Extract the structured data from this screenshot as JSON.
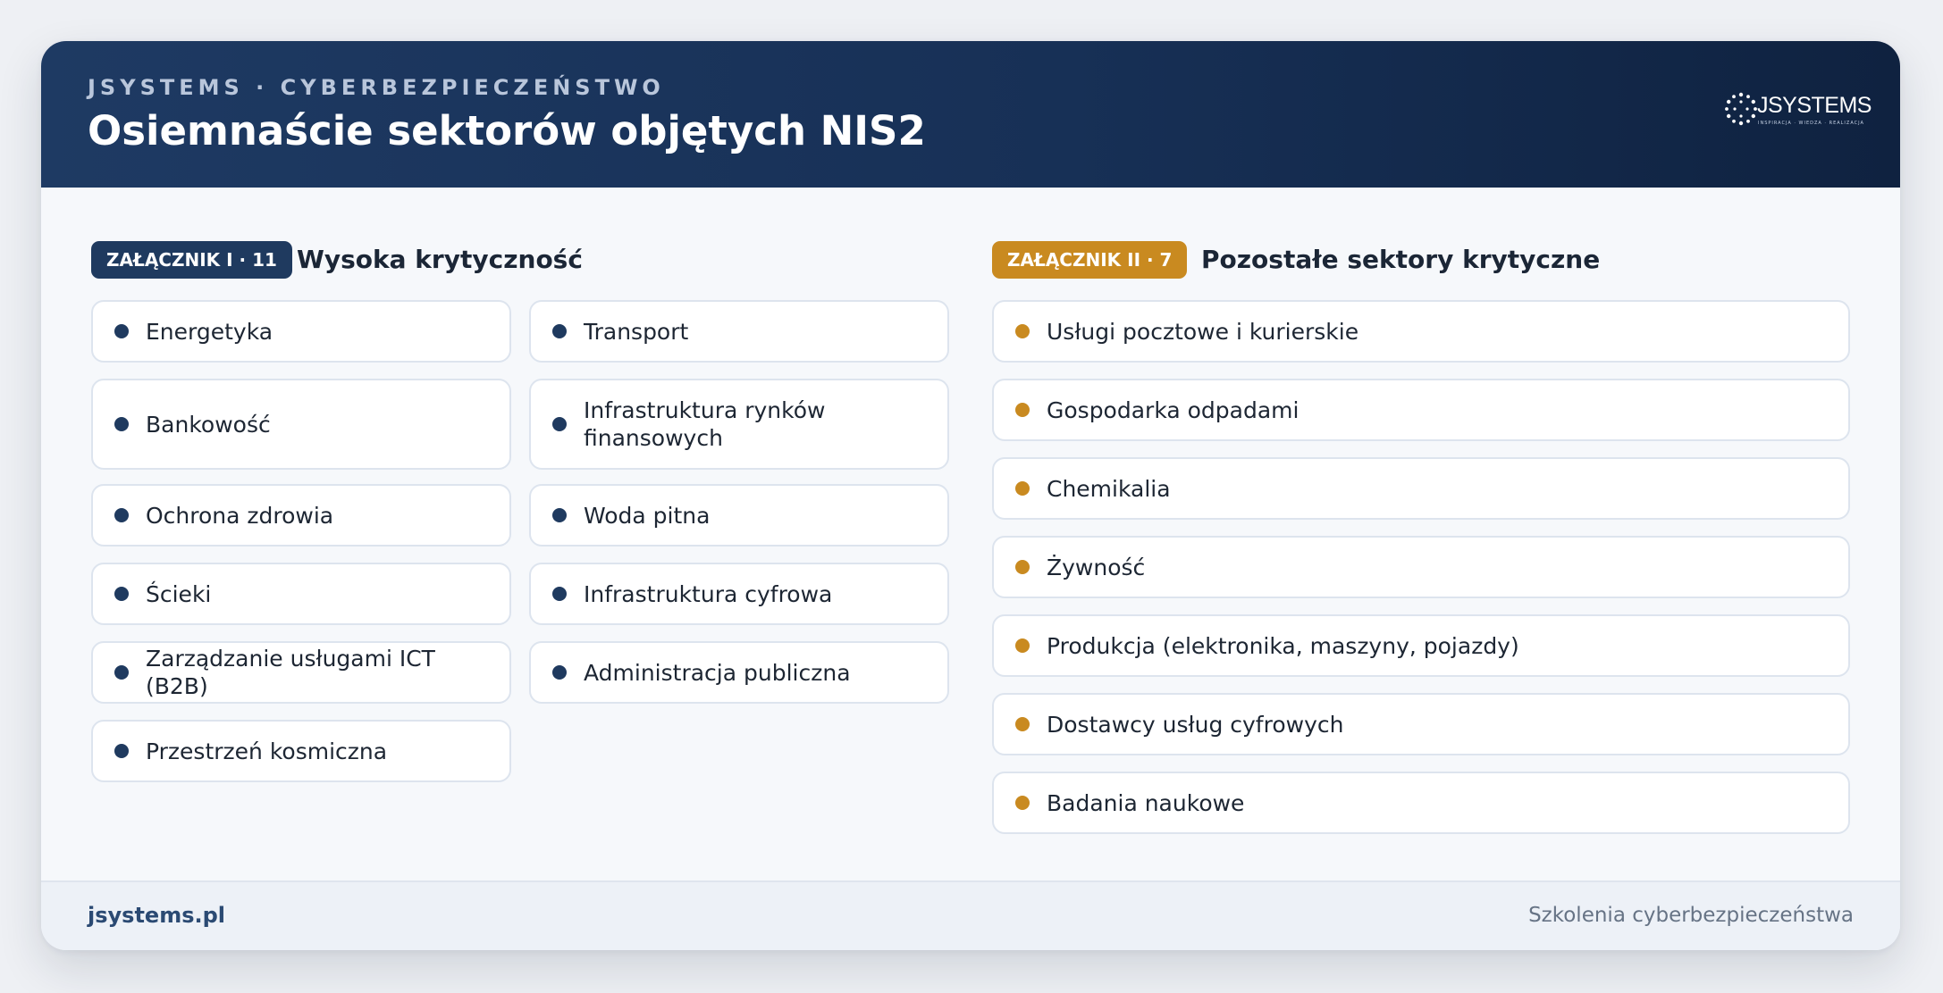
{
  "header": {
    "eyebrow": "JSYSTEMS · CYBERBEZPIECZEŃSTWO",
    "title": "Osiemnaście sektorów objętych NIS2",
    "logo": {
      "wordmark": "JSYSTEMS",
      "tagline": "INSPIRACJA · WIEDZA · REALIZACJA",
      "icon": "dotted-circle-logo-icon"
    }
  },
  "annex1": {
    "badge": "ZAŁĄCZNIK I · 11",
    "title": "Wysoka krytyczność",
    "color": "#1f3a5f",
    "items": [
      "Energetyka",
      "Transport",
      "Bankowość",
      "Infrastruktura rynków finansowych",
      "Ochrona zdrowia",
      "Woda pitna",
      "Ścieki",
      "Infrastruktura cyfrowa",
      "Zarządzanie usługami ICT (B2B)",
      "Administracja publiczna",
      "Przestrzeń kosmiczna"
    ]
  },
  "annex2": {
    "badge": "ZAŁĄCZNIK II · 7",
    "title": "Pozostałe sektory krytyczne",
    "color": "#c98a20",
    "items": [
      "Usługi pocztowe i kurierskie",
      "Gospodarka odpadami",
      "Chemikalia",
      "Żywność",
      "Produkcja (elektronika, maszyny, pojazdy)",
      "Dostawcy usług cyfrowych",
      "Badania naukowe"
    ]
  },
  "footer": {
    "left": "jsystems.pl",
    "right": "Szkolenia cyberbezpieczeństwa"
  }
}
